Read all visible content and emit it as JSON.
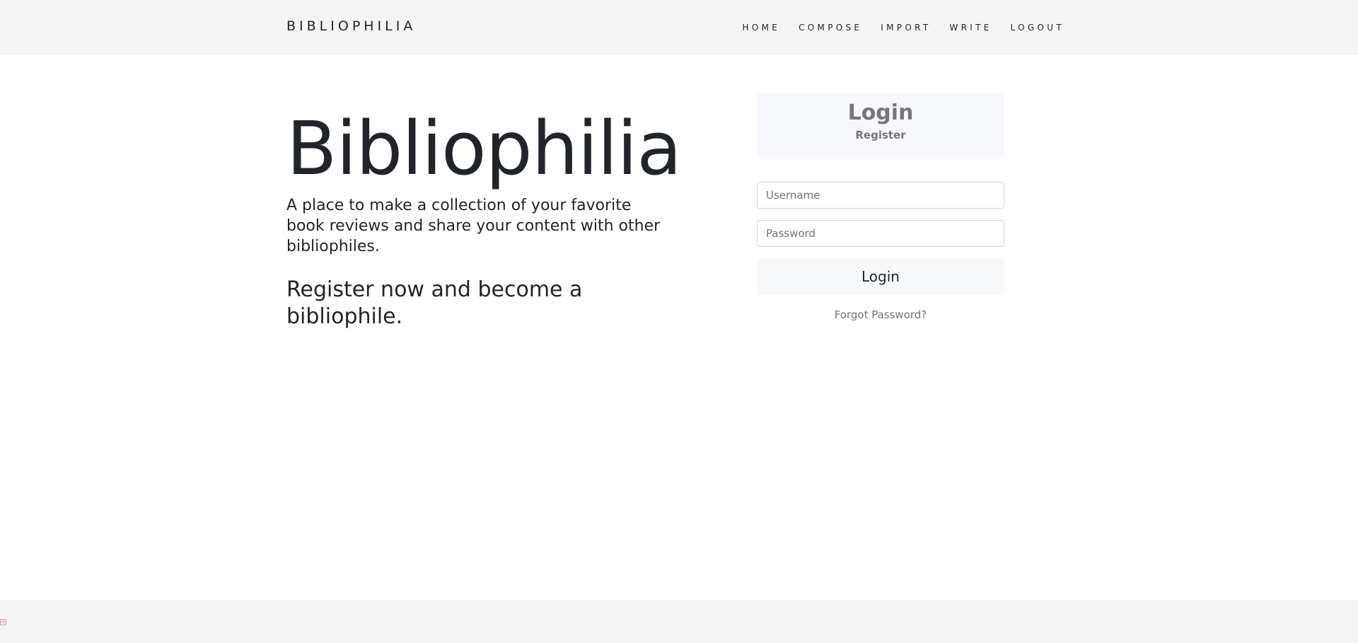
{
  "navbar": {
    "brand": "BIBLIOPHILIA",
    "links": [
      {
        "label": "HOME"
      },
      {
        "label": "COMPOSE"
      },
      {
        "label": "IMPORT"
      },
      {
        "label": "WRITE"
      },
      {
        "label": "LOGOUT"
      }
    ]
  },
  "hero": {
    "title": "Bibliophilia",
    "description": "A place to make a collection of your favorite book reviews and share your content with other bibliophiles.",
    "cta": "Register now and become a bibliophile."
  },
  "auth": {
    "login_tab": "Login",
    "register_tab": "Register",
    "username_placeholder": "Username",
    "password_placeholder": "Password",
    "login_button": "Login",
    "forgot_link": "Forgot Password?"
  },
  "footer": {
    "icon": "broken-image-icon"
  },
  "colors": {
    "navbar_bg": "#f4f4f4",
    "auth_header_bg": "#f7f8fc",
    "muted_text": "#777777"
  }
}
